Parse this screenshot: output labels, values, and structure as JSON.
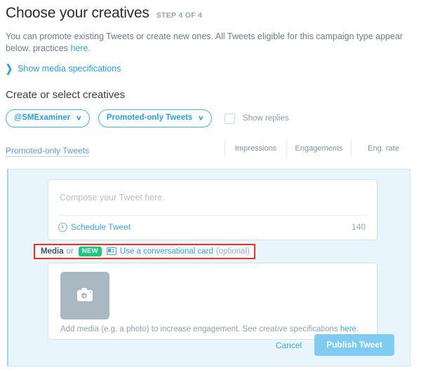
{
  "header": {
    "title": "Choose your creatives",
    "step_label": "STEP 4 OF 4"
  },
  "intro": {
    "line1": "You can promote existing Tweets or create new ones. All Tweets eligible for this campaign type appear below.",
    "line2_prefix": "practices ",
    "line2_link": "here",
    "line2_suffix": "."
  },
  "disclosure": {
    "chevron": "❯",
    "label": "Show media specifications"
  },
  "creatives": {
    "section_title": "Create or select creatives",
    "account_filter": "@SMExaminer",
    "type_filter": "Promoted-only Tweets",
    "caret": "∨",
    "show_replies_label": "Show replies",
    "show_replies_checked": false
  },
  "table": {
    "col_main": "Promoted-only Tweets",
    "col_impressions": "Impressions",
    "col_engagements": "Engagements",
    "col_eng_rate": "Eng. rate"
  },
  "compose": {
    "placeholder": "Compose your Tweet here.",
    "schedule_label": "Schedule Tweet",
    "char_count": "140"
  },
  "media_label": {
    "strong": "Media",
    "or": "or",
    "new_badge": "NEW",
    "conversational_link": "Use a conversational card",
    "optional": "(optional)"
  },
  "media_card": {
    "hint_prefix": "Add media (e.g. a photo) to increase engagement. See creative specifications ",
    "hint_link": "here",
    "hint_suffix": "."
  },
  "actions": {
    "cancel": "Cancel",
    "publish": "Publish Tweet"
  },
  "colors": {
    "link_blue": "#3ba4e8",
    "accent_blue": "#46b3f5",
    "panel_bg": "#e8f5fd",
    "highlight_red": "#ee3124",
    "badge_green": "#1ec77b",
    "publish_blue": "#7fcbf2",
    "thumb_grey": "#aab8c2"
  }
}
